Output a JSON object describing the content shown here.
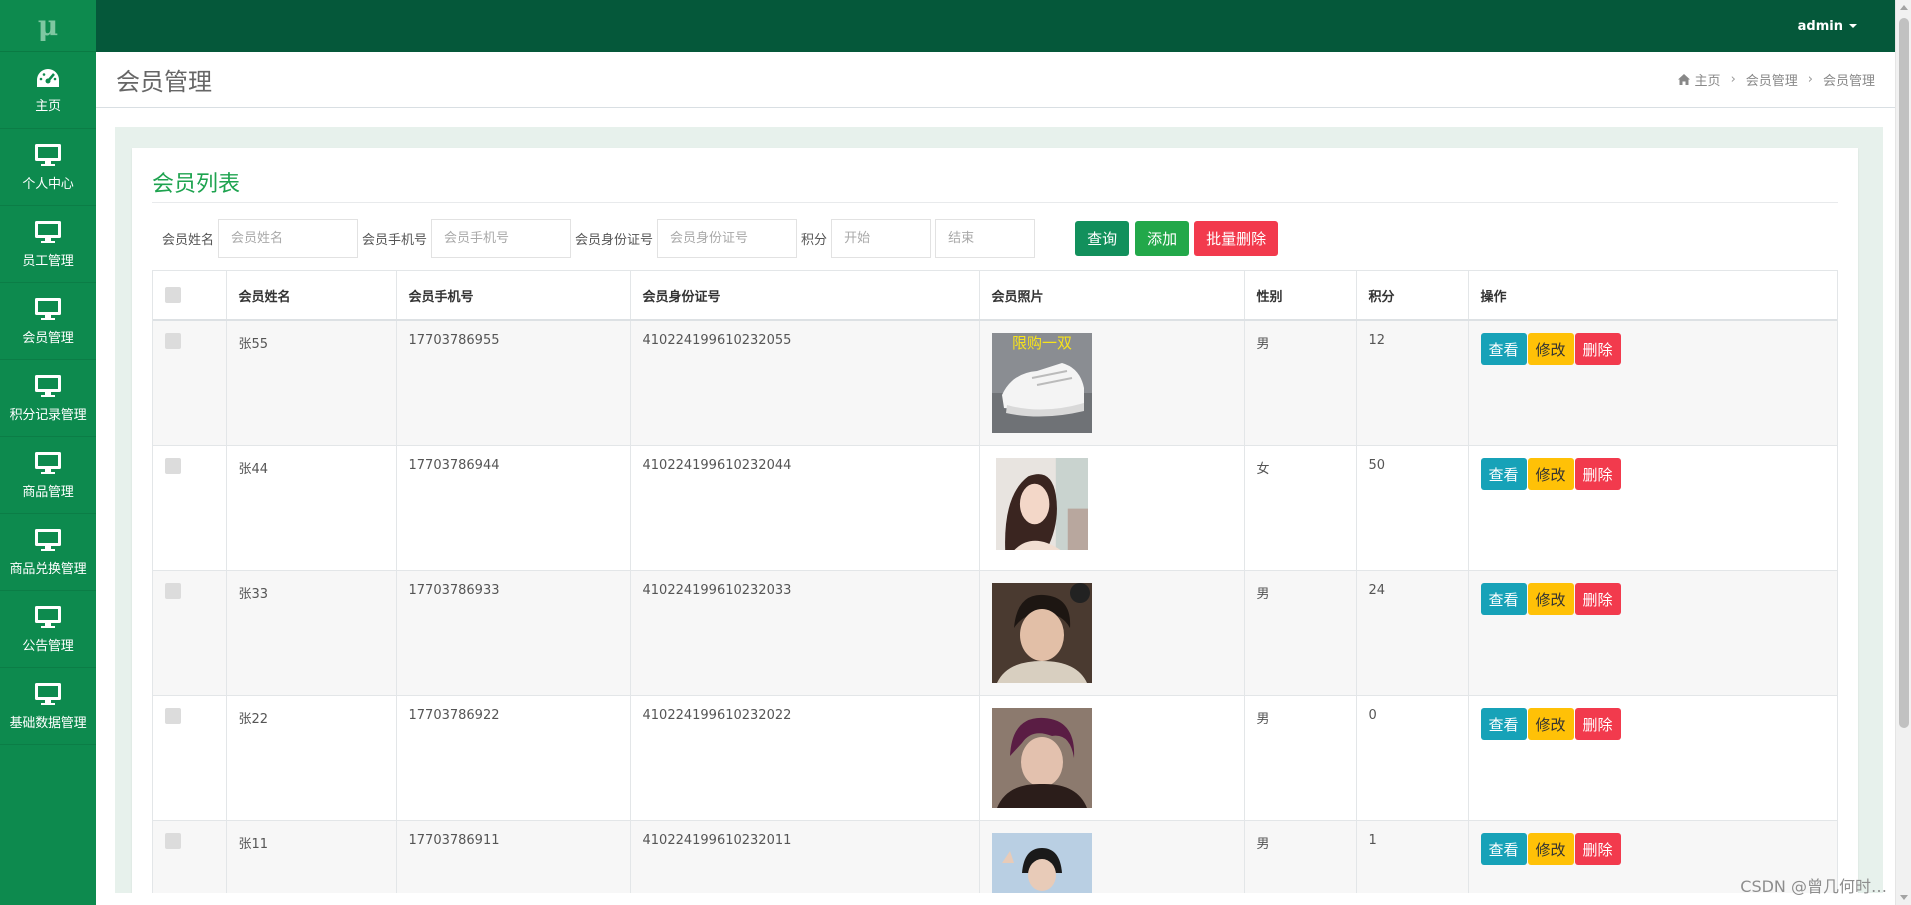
{
  "logo": "μ",
  "sidebar": {
    "items": [
      {
        "label": "主页",
        "icon": "dashboard-icon"
      },
      {
        "label": "个人中心",
        "icon": "monitor-icon"
      },
      {
        "label": "员工管理",
        "icon": "monitor-icon"
      },
      {
        "label": "会员管理",
        "icon": "monitor-icon"
      },
      {
        "label": "积分记录管理",
        "icon": "monitor-icon"
      },
      {
        "label": "商品管理",
        "icon": "monitor-icon"
      },
      {
        "label": "商品兑换管理",
        "icon": "monitor-icon"
      },
      {
        "label": "公告管理",
        "icon": "monitor-icon"
      },
      {
        "label": "基础数据管理",
        "icon": "monitor-icon"
      }
    ]
  },
  "topbar": {
    "user": "admin"
  },
  "header": {
    "title": "会员管理",
    "breadcrumb": [
      "主页",
      "会员管理",
      "会员管理"
    ]
  },
  "card": {
    "title": "会员列表"
  },
  "search": {
    "name_label": "会员姓名",
    "name_placeholder": "会员姓名",
    "phone_label": "会员手机号",
    "phone_placeholder": "会员手机号",
    "id_label": "会员身份证号",
    "id_placeholder": "会员身份证号",
    "points_label": "积分",
    "start_placeholder": "开始",
    "end_placeholder": "结束",
    "query": "查询",
    "add": "添加",
    "batch_delete": "批量删除"
  },
  "table": {
    "headers": [
      "会员姓名",
      "会员手机号",
      "会员身份证号",
      "会员照片",
      "性别",
      "积分",
      "操作"
    ],
    "rows": [
      {
        "name": "张55",
        "phone": "17703786955",
        "idcard": "410224199610232055",
        "photo": "sneaker",
        "photo_text": "限购一双",
        "gender": "男",
        "points": "12"
      },
      {
        "name": "张44",
        "phone": "17703786944",
        "idcard": "410224199610232044",
        "photo": "woman",
        "gender": "女",
        "points": "50"
      },
      {
        "name": "张33",
        "phone": "17703786933",
        "idcard": "410224199610232033",
        "photo": "man1",
        "gender": "男",
        "points": "24"
      },
      {
        "name": "张22",
        "phone": "17703786922",
        "idcard": "410224199610232022",
        "photo": "man2",
        "gender": "男",
        "points": "0"
      },
      {
        "name": "张11",
        "phone": "17703786911",
        "idcard": "410224199610232011",
        "photo": "man3",
        "gender": "男",
        "points": "1"
      }
    ],
    "actions": {
      "view": "查看",
      "edit": "修改",
      "delete": "删除"
    }
  },
  "watermark": "CSDN @曾几何时…"
}
